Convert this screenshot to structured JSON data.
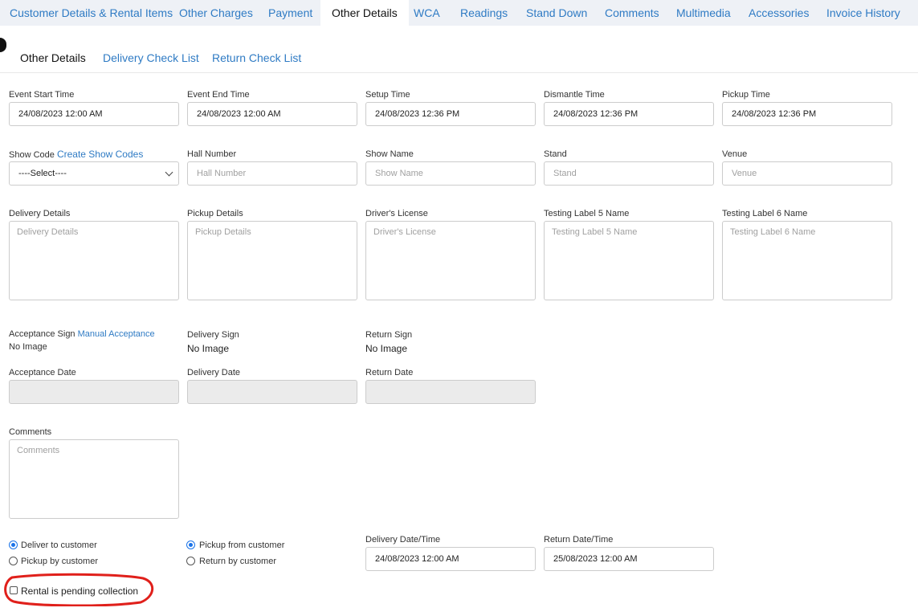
{
  "tabs": [
    {
      "label": "Customer Details & Rental Items"
    },
    {
      "label": "Other Charges"
    },
    {
      "label": "Payment"
    },
    {
      "label": "Other Details"
    },
    {
      "label": "WCA"
    },
    {
      "label": "Readings"
    },
    {
      "label": "Stand Down"
    },
    {
      "label": "Comments"
    },
    {
      "label": "Multimedia"
    },
    {
      "label": "Accessories"
    },
    {
      "label": "Invoice History"
    }
  ],
  "active_tab": "Other Details",
  "subtabs": [
    {
      "label": "Other Details"
    },
    {
      "label": "Delivery Check List"
    },
    {
      "label": "Return Check List"
    }
  ],
  "times": {
    "event_start": {
      "label": "Event Start Time",
      "value": "24/08/2023 12:00 AM"
    },
    "event_end": {
      "label": "Event End Time",
      "value": "24/08/2023 12:00 AM"
    },
    "setup": {
      "label": "Setup Time",
      "value": "24/08/2023 12:36 PM"
    },
    "dismantle": {
      "label": "Dismantle Time",
      "value": "24/08/2023 12:36 PM"
    },
    "pickup": {
      "label": "Pickup Time",
      "value": "24/08/2023 12:36 PM"
    }
  },
  "show": {
    "show_code_label": "Show Code",
    "create_link": "Create Show Codes",
    "select_value": "----Select----",
    "hall_label": "Hall Number",
    "hall_placeholder": "Hall Number",
    "show_name_label": "Show Name",
    "show_name_placeholder": "Show Name",
    "stand_label": "Stand",
    "stand_placeholder": "Stand",
    "venue_label": "Venue",
    "venue_placeholder": "Venue"
  },
  "details": {
    "delivery_label": "Delivery Details",
    "delivery_placeholder": "Delivery Details",
    "pickup_label": "Pickup Details",
    "pickup_placeholder": "Pickup Details",
    "license_label": "Driver's License",
    "license_placeholder": "Driver's License",
    "testing5_label": "Testing Label 5 Name",
    "testing5_placeholder": "Testing Label 5 Name",
    "testing6_label": "Testing Label 6 Name",
    "testing6_placeholder": "Testing Label 6 Name"
  },
  "signs": {
    "acceptance_label": "Acceptance Sign",
    "manual_link": "Manual Acceptance",
    "acceptance_value": "No Image",
    "delivery_label": "Delivery Sign",
    "delivery_value": "No Image",
    "return_label": "Return Sign",
    "return_value": "No Image",
    "acceptance_date_label": "Acceptance Date",
    "delivery_date_label": "Delivery Date",
    "return_date_label": "Return Date"
  },
  "comments": {
    "label": "Comments",
    "placeholder": "Comments"
  },
  "delivery_options": [
    {
      "label": "Deliver to customer",
      "checked": true
    },
    {
      "label": "Pickup by customer",
      "checked": false
    }
  ],
  "return_options": [
    {
      "label": "Pickup from customer",
      "checked": true
    },
    {
      "label": "Return by customer",
      "checked": false
    }
  ],
  "delivery_datetime": {
    "label": "Delivery Date/Time",
    "value": "24/08/2023 12:00 AM"
  },
  "return_datetime": {
    "label": "Return Date/Time",
    "value": "25/08/2023 12:00 AM"
  },
  "pending": {
    "label": "Rental is pending collection",
    "checked": false
  },
  "colors": {
    "link": "#2f7bc4",
    "tabbar": "#eef1f6",
    "highlight_circle": "#e0201b",
    "radio": "#1a73e8"
  }
}
